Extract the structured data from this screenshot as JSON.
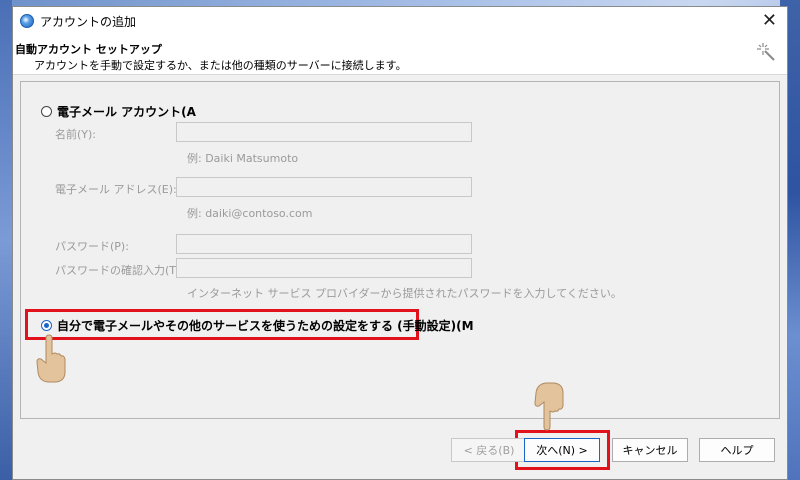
{
  "window": {
    "title": "アカウントの追加",
    "close_label": "✕"
  },
  "header": {
    "title": "自動アカウント セットアップ",
    "subtitle": "アカウントを手動で設定するか、または他の種類のサーバーに接続します。"
  },
  "form": {
    "email_account_option": "電子メール アカウント(A",
    "name_label": "名前(Y):",
    "name_hint": "例: Daiki Matsumoto",
    "email_label": "電子メール アドレス(E):",
    "email_hint": "例: daiki@contoso.com",
    "password_label": "パスワード(P):",
    "password_confirm_label": "パスワードの確認入力(T):",
    "password_hint": "インターネット サービス プロバイダーから提供されたパスワードを入力してください。",
    "manual_option": "自分で電子メールやその他のサービスを使うための設定をする (手動設定)(M"
  },
  "footer": {
    "back_label": "< 戻る(B)",
    "next_label": "次へ(N) >",
    "cancel_label": "キャンセル",
    "help_label": "ヘルプ"
  },
  "colors": {
    "highlight": "#e1121b",
    "radio_selected": "#1b64c8"
  }
}
